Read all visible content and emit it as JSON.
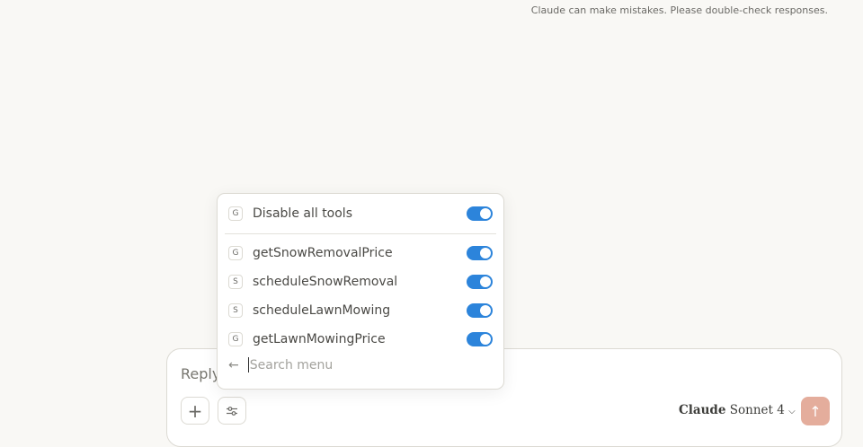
{
  "disclaimer": "Claude can make mistakes. Please double-check responses.",
  "composer": {
    "placeholder": "Reply",
    "model_brand": "Claude",
    "model_name": "Sonnet 4"
  },
  "tools_menu": {
    "master": {
      "badge": "G",
      "label": "Disable all tools",
      "enabled": true
    },
    "tools": [
      {
        "badge": "G",
        "label": "getSnowRemovalPrice",
        "enabled": true
      },
      {
        "badge": "S",
        "label": "scheduleSnowRemoval",
        "enabled": true
      },
      {
        "badge": "S",
        "label": "scheduleLawnMowing",
        "enabled": true
      },
      {
        "badge": "G",
        "label": "getLawnMowingPrice",
        "enabled": true
      }
    ],
    "search_placeholder": "Search menu"
  },
  "colors": {
    "toggle_on": "#2c84db",
    "send": "#e4ad9c",
    "logo": "#d97757"
  }
}
